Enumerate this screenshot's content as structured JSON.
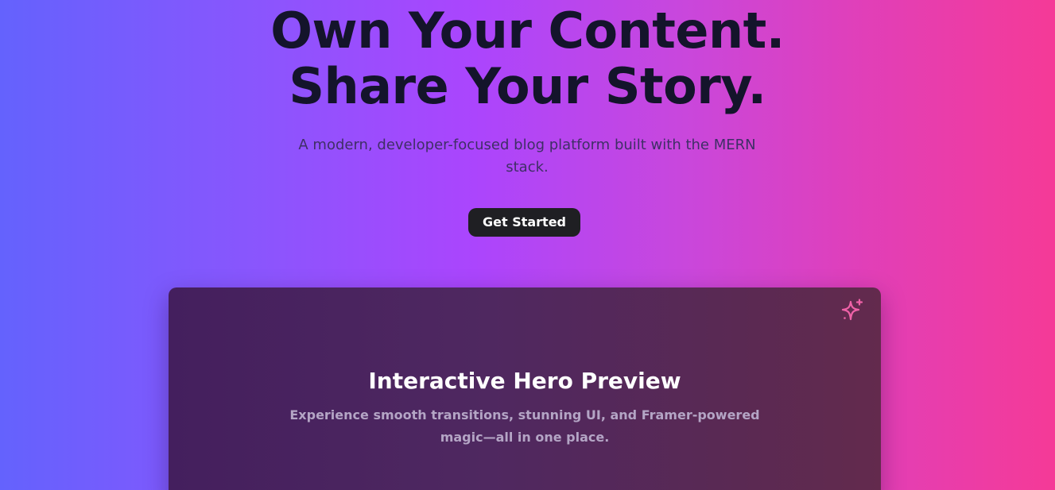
{
  "hero": {
    "headline_line1": "Own Your Content.",
    "headline_line2": "Share Your Story.",
    "subtitle": "A modern, developer-focused blog platform built with the MERN stack.",
    "cta_label": "Get Started"
  },
  "preview_card": {
    "icon": "sparkles-icon",
    "title": "Interactive Hero Preview",
    "description": "Experience smooth transitions, stunning UI, and Framer-powered magic—all in one place."
  },
  "colors": {
    "headline": "#14142b",
    "cta_background": "#1f1f23",
    "sparkle_accent": "#f062a8",
    "gradient_start": "#6462fd",
    "gradient_mid": "#ab45fd",
    "gradient_end": "#f53a97"
  }
}
